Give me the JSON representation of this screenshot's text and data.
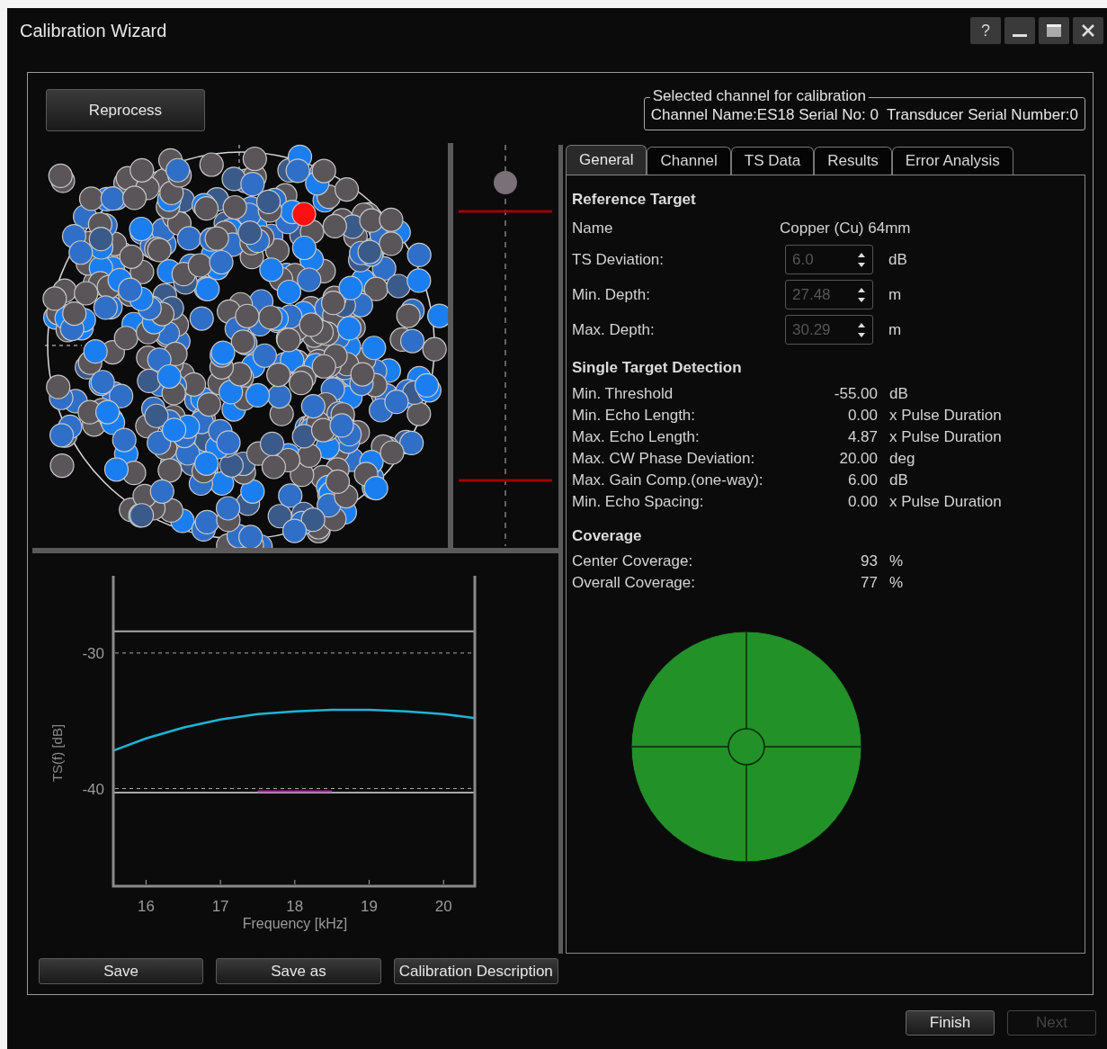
{
  "window": {
    "title": "Calibration Wizard",
    "help_button": "?"
  },
  "reprocess_button": "Reprocess",
  "channel_group": {
    "legend": "Selected channel for calibration",
    "text": "Channel Name:ES18 Serial No: 0  Transducer Serial Number:0"
  },
  "tabs": [
    {
      "label": "General",
      "selected": true
    },
    {
      "label": "Channel",
      "selected": false
    },
    {
      "label": "TS Data",
      "selected": false
    },
    {
      "label": "Results",
      "selected": false
    },
    {
      "label": "Error Analysis",
      "selected": false
    }
  ],
  "reference_target": {
    "heading": "Reference Target",
    "rows": [
      {
        "kind": "text",
        "label": "Name",
        "value": "Copper (Cu) 64mm"
      },
      {
        "kind": "spin",
        "label": "TS Deviation:",
        "value": "6.0",
        "unit": "dB",
        "disabled": true
      },
      {
        "kind": "spin",
        "label": "Min. Depth:",
        "value": "27.48",
        "unit": "m",
        "disabled": true
      },
      {
        "kind": "spin",
        "label": "Max. Depth:",
        "value": "30.29",
        "unit": "m",
        "disabled": true
      }
    ]
  },
  "single_target_detection": {
    "heading": "Single Target Detection",
    "rows": [
      {
        "label": "Min. Threshold",
        "value": "-55.00",
        "unit": "dB"
      },
      {
        "label": "Min. Echo Length:",
        "value": "0.00",
        "unit": "x Pulse Duration"
      },
      {
        "label": "Max. Echo Length:",
        "value": "4.87",
        "unit": "x Pulse Duration"
      },
      {
        "label": "Max. CW Phase Deviation:",
        "value": "20.00",
        "unit": "deg"
      },
      {
        "label": "Max. Gain Comp.(one-way):",
        "value": "6.00",
        "unit": "dB"
      },
      {
        "label": "Min. Echo Spacing:",
        "value": "0.00",
        "unit": "x Pulse Duration"
      }
    ]
  },
  "coverage": {
    "heading": "Coverage",
    "rows": [
      {
        "label": "Center Coverage:",
        "value": "93",
        "unit": "%"
      },
      {
        "label": "Overall Coverage:",
        "value": "77",
        "unit": "%"
      }
    ]
  },
  "ts_chart": {
    "chart_data": {
      "type": "line",
      "xlabel": "Frequency [kHz]",
      "ylabel": "TS(f) [dB]",
      "x": [
        15.56,
        16,
        16.5,
        17,
        17.5,
        18,
        18.5,
        19,
        19.5,
        20,
        20.42
      ],
      "xlim": [
        15.56,
        20.42
      ],
      "ylim": [
        -47.2,
        -24.3
      ],
      "xticks": [
        16,
        17,
        18,
        19,
        20
      ],
      "yticks": [
        -30,
        -40
      ],
      "ref_lines": [
        {
          "axis": "y",
          "value": -30,
          "color": "#aaaaaa"
        },
        {
          "axis": "y",
          "value": -40,
          "color": "#aaaaaa"
        }
      ],
      "series": [
        {
          "color": "#1ab6d6",
          "values": [
            -37.2,
            -36.3,
            -35.5,
            -34.9,
            -34.5,
            -34.3,
            -34.2,
            -34.2,
            -34.3,
            -34.5,
            -34.8
          ]
        },
        {
          "color": "#a8a8a8",
          "values": [
            -28.4,
            -28.4,
            -28.4,
            -28.4,
            -28.4,
            -28.4,
            -28.4,
            -28.4,
            -28.4,
            -28.4,
            -28.4
          ]
        },
        {
          "color": "#a8a8a8",
          "values": [
            -40.3,
            -40.3,
            -40.3,
            -40.3,
            -40.3,
            -40.3,
            -40.3,
            -40.3,
            -40.3,
            -40.3,
            -40.3
          ]
        },
        {
          "color": "#b01cb0",
          "values": [
            null,
            null,
            null,
            null,
            -40.2,
            -40.2,
            -40.2,
            null,
            null,
            null,
            null
          ]
        }
      ]
    }
  },
  "bottom_buttons": [
    {
      "label": "Save"
    },
    {
      "label": "Save as"
    },
    {
      "label": "Calibration Description"
    }
  ],
  "footer_buttons": [
    {
      "label": "Finish",
      "disabled": false
    },
    {
      "label": "Next",
      "disabled": true
    }
  ]
}
